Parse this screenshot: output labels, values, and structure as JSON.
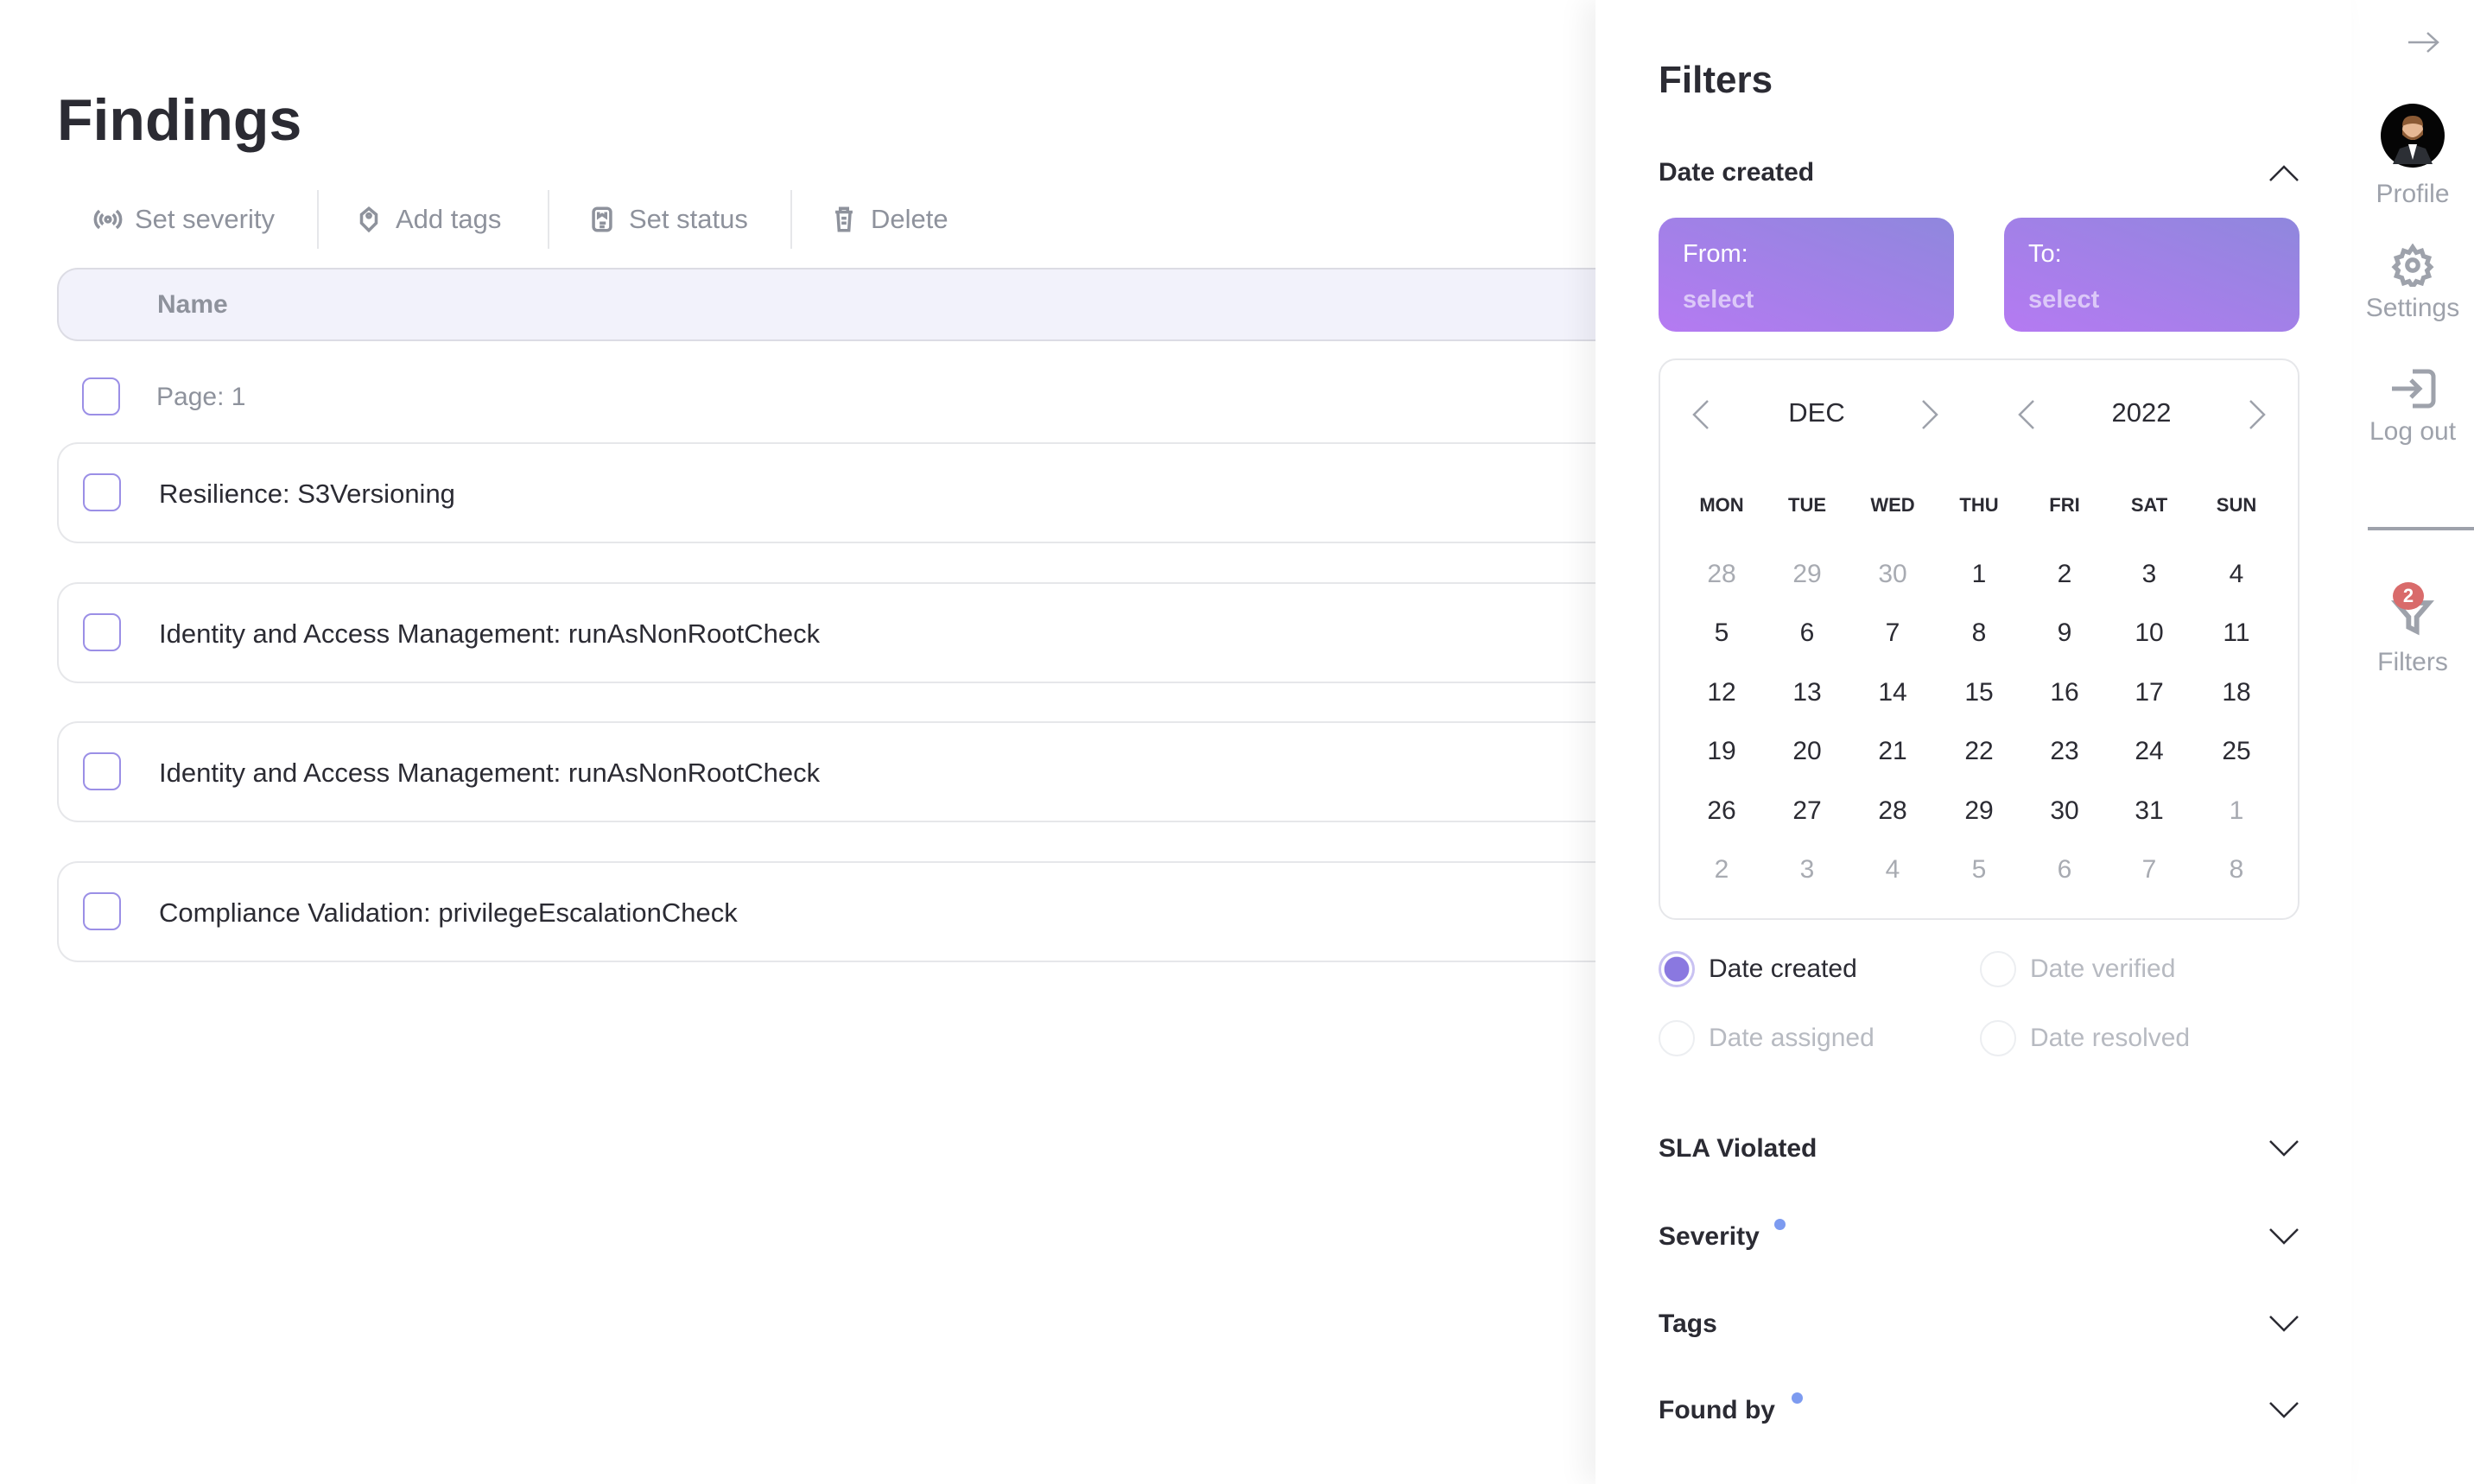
{
  "page": {
    "title": "Findings"
  },
  "toolbar": {
    "set_severity": "Set severity",
    "add_tags": "Add tags",
    "set_status": "Set status",
    "delete": "Delete"
  },
  "table": {
    "header_name": "Name",
    "page_label": "Page: 1",
    "rows": [
      "Resilience: S3Versioning",
      "Identity and Access Management: runAsNonRootCheck",
      "Identity and Access Management: runAsNonRootCheck",
      "Compliance Validation: privilegeEscalationCheck"
    ]
  },
  "filters": {
    "title": "Filters",
    "date_created": {
      "label": "Date created",
      "from_label": "From:",
      "from_value": "select",
      "to_label": "To:",
      "to_value": "select"
    },
    "calendar": {
      "month": "DEC",
      "year": "2022",
      "weekdays": [
        "MON",
        "TUE",
        "WED",
        "THU",
        "FRI",
        "SAT",
        "SUN"
      ],
      "weeks": [
        [
          "28",
          "29",
          "30",
          "1",
          "2",
          "3",
          "4"
        ],
        [
          "5",
          "6",
          "7",
          "8",
          "9",
          "10",
          "11"
        ],
        [
          "12",
          "13",
          "14",
          "15",
          "16",
          "17",
          "18"
        ],
        [
          "19",
          "20",
          "21",
          "22",
          "23",
          "24",
          "25"
        ],
        [
          "26",
          "27",
          "28",
          "29",
          "30",
          "31",
          "1"
        ],
        [
          "2",
          "3",
          "4",
          "5",
          "6",
          "7",
          "8"
        ]
      ]
    },
    "date_types": [
      {
        "label": "Date created",
        "selected": true
      },
      {
        "label": "Date verified",
        "selected": false
      },
      {
        "label": "Date assigned",
        "selected": false
      },
      {
        "label": "Date resolved",
        "selected": false
      }
    ],
    "sections": {
      "sla": "SLA Violated",
      "severity": "Severity",
      "tags": "Tags",
      "found_by": "Found by"
    }
  },
  "sidebar": {
    "profile": "Profile",
    "settings": "Settings",
    "logout": "Log out",
    "filters": "Filters",
    "filters_badge": "2"
  },
  "colors": {
    "accent": "#8f87dd",
    "badge": "#d96b6b",
    "dot": "#7d9bf0"
  }
}
